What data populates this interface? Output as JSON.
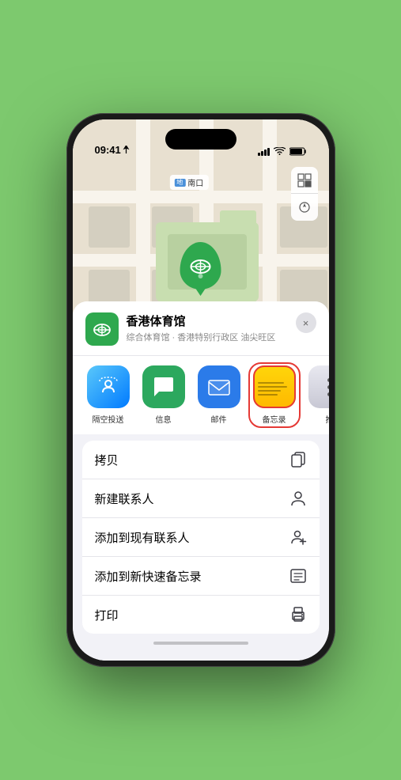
{
  "status": {
    "time": "09:41",
    "location_arrow": "▸"
  },
  "map": {
    "label_text": "南口",
    "marker_label": "香港体育馆"
  },
  "venue_card": {
    "name": "香港体育馆",
    "subtitle": "综合体育馆 · 香港特别行政区 油尖旺区",
    "close_label": "×"
  },
  "share_items": [
    {
      "id": "airdrop",
      "label": "隔空投送",
      "type": "airdrop"
    },
    {
      "id": "message",
      "label": "信息",
      "type": "message"
    },
    {
      "id": "mail",
      "label": "邮件",
      "type": "mail"
    },
    {
      "id": "notes",
      "label": "备忘录",
      "type": "notes"
    },
    {
      "id": "more",
      "label": "推",
      "type": "more"
    }
  ],
  "action_items": [
    {
      "id": "copy",
      "label": "拷贝",
      "icon": "copy"
    },
    {
      "id": "new-contact",
      "label": "新建联系人",
      "icon": "person"
    },
    {
      "id": "add-contact",
      "label": "添加到现有联系人",
      "icon": "person-add"
    },
    {
      "id": "quick-note",
      "label": "添加到新快速备忘录",
      "icon": "note"
    },
    {
      "id": "print",
      "label": "打印",
      "icon": "print"
    }
  ],
  "colors": {
    "green": "#2ea84e",
    "blue": "#007aff",
    "red": "#e53935",
    "map_bg": "#e8e0d0",
    "phone_bg": "#7dc96e"
  }
}
